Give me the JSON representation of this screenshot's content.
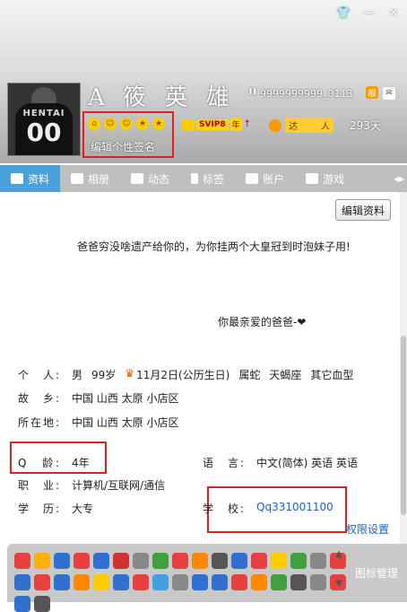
{
  "header": {
    "nickname": "A 筱 英 雄 \"",
    "qq_number": "9999999999_0113",
    "qq_icons": [
      "qq-level-icon",
      "qq-mail-icon"
    ],
    "svip_label": "SVIP8",
    "svip_year": "年",
    "daren_label": "达人",
    "days": "293天",
    "signature": "编辑个性签名",
    "level_badges": [
      "house",
      "sun",
      "sun",
      "star",
      "star"
    ]
  },
  "window": {
    "icons": [
      "skin-icon",
      "minimize-icon",
      "close-icon"
    ]
  },
  "tabs": [
    {
      "label": "资料",
      "icon": "profile-card-icon",
      "active": true
    },
    {
      "label": "相册",
      "icon": "photo-icon"
    },
    {
      "label": "动态",
      "icon": "feed-icon"
    },
    {
      "label": "标签",
      "icon": "bookmark-icon"
    },
    {
      "label": "账户",
      "icon": "wallet-icon"
    },
    {
      "label": "游戏",
      "icon": "gamepad-icon"
    }
  ],
  "content": {
    "edit_button": "编辑资料",
    "bio_line1": "爸爸穷没啥遗产给你的，为你挂两个大皇冠到时泡妹子用!",
    "bio_line2": "你最亲爱的爸爸-❤",
    "personal": {
      "label": "个　人:",
      "gender": "男",
      "age": "99岁",
      "birthday": "11月2日(公历生日)",
      "zodiac": "属蛇",
      "constellation": "天蝎座",
      "blood": "其它血型"
    },
    "hometown": {
      "label": "故　乡:",
      "value": "中国 山西 太原 小店区"
    },
    "location": {
      "label": "所在地:",
      "value": "中国 山西 太原 小店区"
    },
    "qage": {
      "label": "Q　龄:",
      "value": "4年"
    },
    "language": {
      "label": "语　言:",
      "value": "中文(简体) 英语 英语"
    },
    "job": {
      "label": "职　业:",
      "value": "计算机/互联网/通信"
    },
    "education": {
      "label": "学　历:",
      "value": "大专"
    },
    "school": {
      "label": "学　校:",
      "value": "Qq331001100"
    },
    "permission_link": "权限设置"
  },
  "toolbar": {
    "manage_label": "图标管理",
    "icon_colors": [
      "#e84040",
      "#ffb000",
      "#3070d0",
      "#e84040",
      "#3070d0",
      "#d03030",
      "#888",
      "#40a040",
      "#e84040",
      "#ff8800",
      "#555",
      "#3070d0",
      "#e84040",
      "#ffcc00",
      "#40a040",
      "#888",
      "#e84040",
      "#3070d0",
      "#e84040",
      "#3070d0",
      "#ff8800",
      "#ffcc00",
      "#3070d0",
      "#e84040",
      "#40a0e0",
      "#888",
      "#3070d0",
      "#3070d0",
      "#e84040",
      "#ff8800",
      "#40a040",
      "#555",
      "#888",
      "#e84040",
      "#3070d0",
      "#555"
    ]
  }
}
